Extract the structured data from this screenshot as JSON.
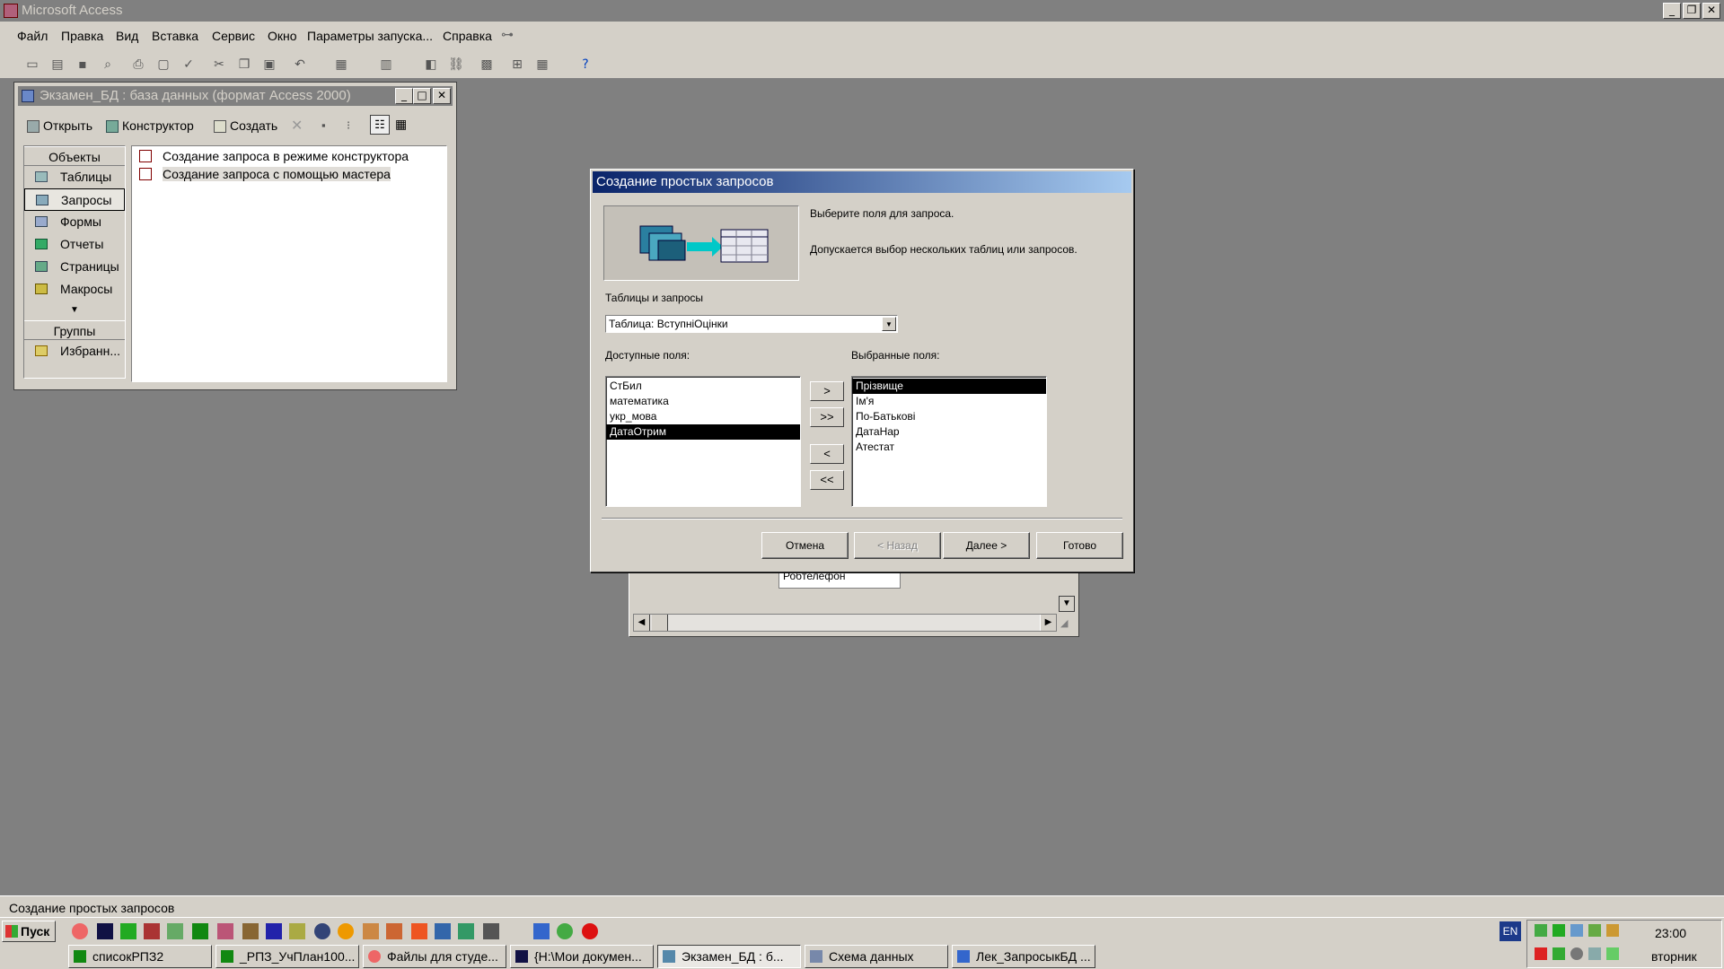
{
  "app": {
    "title": "Microsoft Access"
  },
  "menu": [
    "Файл",
    "Правка",
    "Вид",
    "Вставка",
    "Сервис",
    "Окно",
    "Параметры запуска...",
    "Справка"
  ],
  "dbwindow": {
    "title": "Экзамен_БД : база данных (формат Access 2000)",
    "toolbar": {
      "open": "Открыть",
      "design": "Конструктор",
      "create": "Создать"
    },
    "objects_header": "Объекты",
    "objects": [
      "Таблицы",
      "Запросы",
      "Формы",
      "Отчеты",
      "Страницы",
      "Макросы"
    ],
    "groups_header": "Группы",
    "groups": [
      "Избранн..."
    ],
    "items": [
      "Создание запроса в режиме конструктора",
      "Создание запроса с помощью мастера"
    ]
  },
  "bgwindow": {
    "field": "Робтелефон"
  },
  "dialog": {
    "title": "Создание простых запросов",
    "instruction1": "Выберите поля для запроса.",
    "instruction2": "Допускается выбор нескольких таблиц или запросов.",
    "tables_label": "Таблицы и запросы",
    "tables_value": "Таблица: ВступніОцінки",
    "available_label": "Доступные поля:",
    "available_fields": [
      "СтБил",
      "математика",
      "укр_мова",
      "ДатаОтрим"
    ],
    "selected_label": "Выбранные поля:",
    "selected_fields": [
      "Прізвище",
      "Ім'я",
      "По-Батькові",
      "ДатаНар",
      "Атестат"
    ],
    "move": {
      "one": ">",
      "all": ">>",
      "back": "<",
      "back_all": "<<"
    },
    "buttons": {
      "cancel": "Отмена",
      "back": "< Назад",
      "next": "Далее >",
      "finish": "Готово"
    }
  },
  "status": {
    "text": "Создание простых запросов"
  },
  "taskbar": {
    "start": "Пуск",
    "tasks": [
      "списокРПЗ2",
      "_РПЗ_УчПлан100...",
      "Файлы для студе...",
      "{H:\\Мои докумен...",
      "Экзамен_БД : б...",
      "Схема данных",
      "Лек_ЗапросыкБД ..."
    ],
    "lang": "EN",
    "time": "23:00",
    "day": "вторник"
  }
}
